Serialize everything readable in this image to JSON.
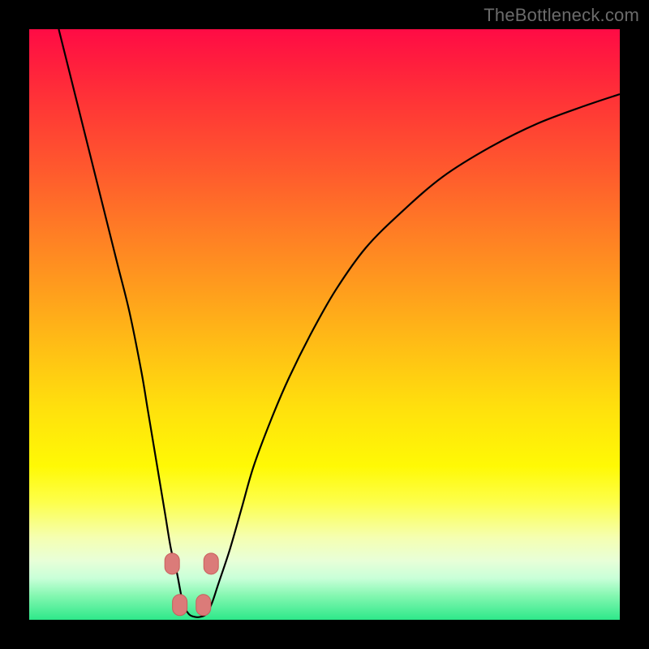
{
  "watermark": "TheBottleneck.com",
  "colors": {
    "frame_bg": "#000000",
    "curve_stroke": "#000000",
    "marker_fill": "#db7b79",
    "marker_stroke": "#c85e5c"
  },
  "chart_data": {
    "type": "line",
    "title": "",
    "xlabel": "",
    "ylabel": "",
    "xlim": [
      0,
      100
    ],
    "ylim": [
      0,
      100
    ],
    "grid": false,
    "series": [
      {
        "name": "bottleneck-curve",
        "x": [
          5,
          7,
          9,
          11,
          13,
          15,
          17,
          19,
          20,
          21,
          22,
          23,
          24,
          25,
          26,
          27,
          28,
          29,
          30,
          31,
          32,
          34,
          36,
          38,
          41,
          44,
          48,
          52,
          57,
          63,
          70,
          78,
          86,
          94,
          100
        ],
        "y": [
          100,
          92,
          84,
          76,
          68,
          60,
          52,
          42,
          36,
          30,
          24,
          18,
          12,
          8,
          3,
          1,
          0.5,
          0.5,
          1,
          3,
          6,
          12,
          19,
          26,
          34,
          41,
          49,
          56,
          63,
          69,
          75,
          80,
          84,
          87,
          89
        ]
      }
    ],
    "markers": [
      {
        "x": 24.2,
        "y": 9.5
      },
      {
        "x": 25.5,
        "y": 2.5
      },
      {
        "x": 29.5,
        "y": 2.5
      },
      {
        "x": 30.8,
        "y": 9.5
      }
    ]
  }
}
